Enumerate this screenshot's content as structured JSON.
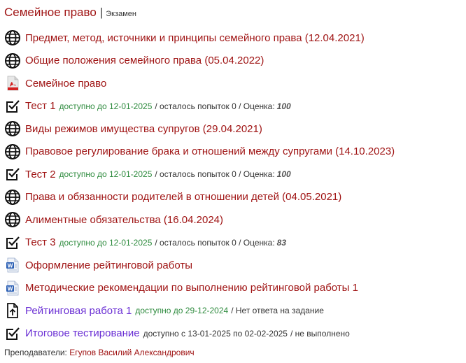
{
  "header": {
    "title": "Семейное право",
    "separator": "|",
    "exam_label": "Экзамен"
  },
  "items": [
    {
      "icon": "globe-icon",
      "label": "Предмет, метод, источники и принципы семейного права (12.04.2021)"
    },
    {
      "icon": "globe-icon",
      "label": "Общие положения семейного права (05.04.2022)"
    },
    {
      "icon": "pdf-icon",
      "label": "Семейное право"
    },
    {
      "icon": "checkbox-icon",
      "label": "Тест 1",
      "available": "доступно до 12-01-2025",
      "info": "/ осталось попыток 0 / Оценка:",
      "score": "100"
    },
    {
      "icon": "globe-icon",
      "label": "Виды режимов имущества супругов (29.04.2021)"
    },
    {
      "icon": "globe-icon",
      "label": "Правовое регулирование брака и отношений между супругами (14.10.2023)"
    },
    {
      "icon": "checkbox-icon",
      "label": "Тест 2",
      "available": "доступно до 12-01-2025",
      "info": "/ осталось попыток 0 / Оценка:",
      "score": "100"
    },
    {
      "icon": "globe-icon",
      "label": "Права и обязанности родителей в отношении детей (04.05.2021)"
    },
    {
      "icon": "globe-icon",
      "label": "Алиментные обязательства (16.04.2024)"
    },
    {
      "icon": "checkbox-icon",
      "label": "Тест 3",
      "available": "доступно до 12-01-2025",
      "info": "/ осталось попыток 0 / Оценка:",
      "score": "83"
    },
    {
      "icon": "word-doc-icon",
      "label": "Оформление рейтинговой работы"
    },
    {
      "icon": "word-doc-icon",
      "label": "Методические рекомендации по выполнению рейтинговой работы 1"
    },
    {
      "icon": "upload-file-icon",
      "label": "Рейтинговая работа 1",
      "available": "доступно до 29-12-2024",
      "info": "/ Нет ответа на задание"
    },
    {
      "icon": "checkbox-icon",
      "label": "Итоговое тестирование",
      "available_dark": "доступно с 13-01-2025 по 02-02-2025",
      "info": "/ не выполнено"
    }
  ],
  "footer": {
    "label": "Преподаватели:",
    "teacher": "Егупов Василий Александрович"
  },
  "colors": {
    "link": "#a01515",
    "link_purple": "#6a2fd4",
    "available_green": "#2e8b3e"
  }
}
